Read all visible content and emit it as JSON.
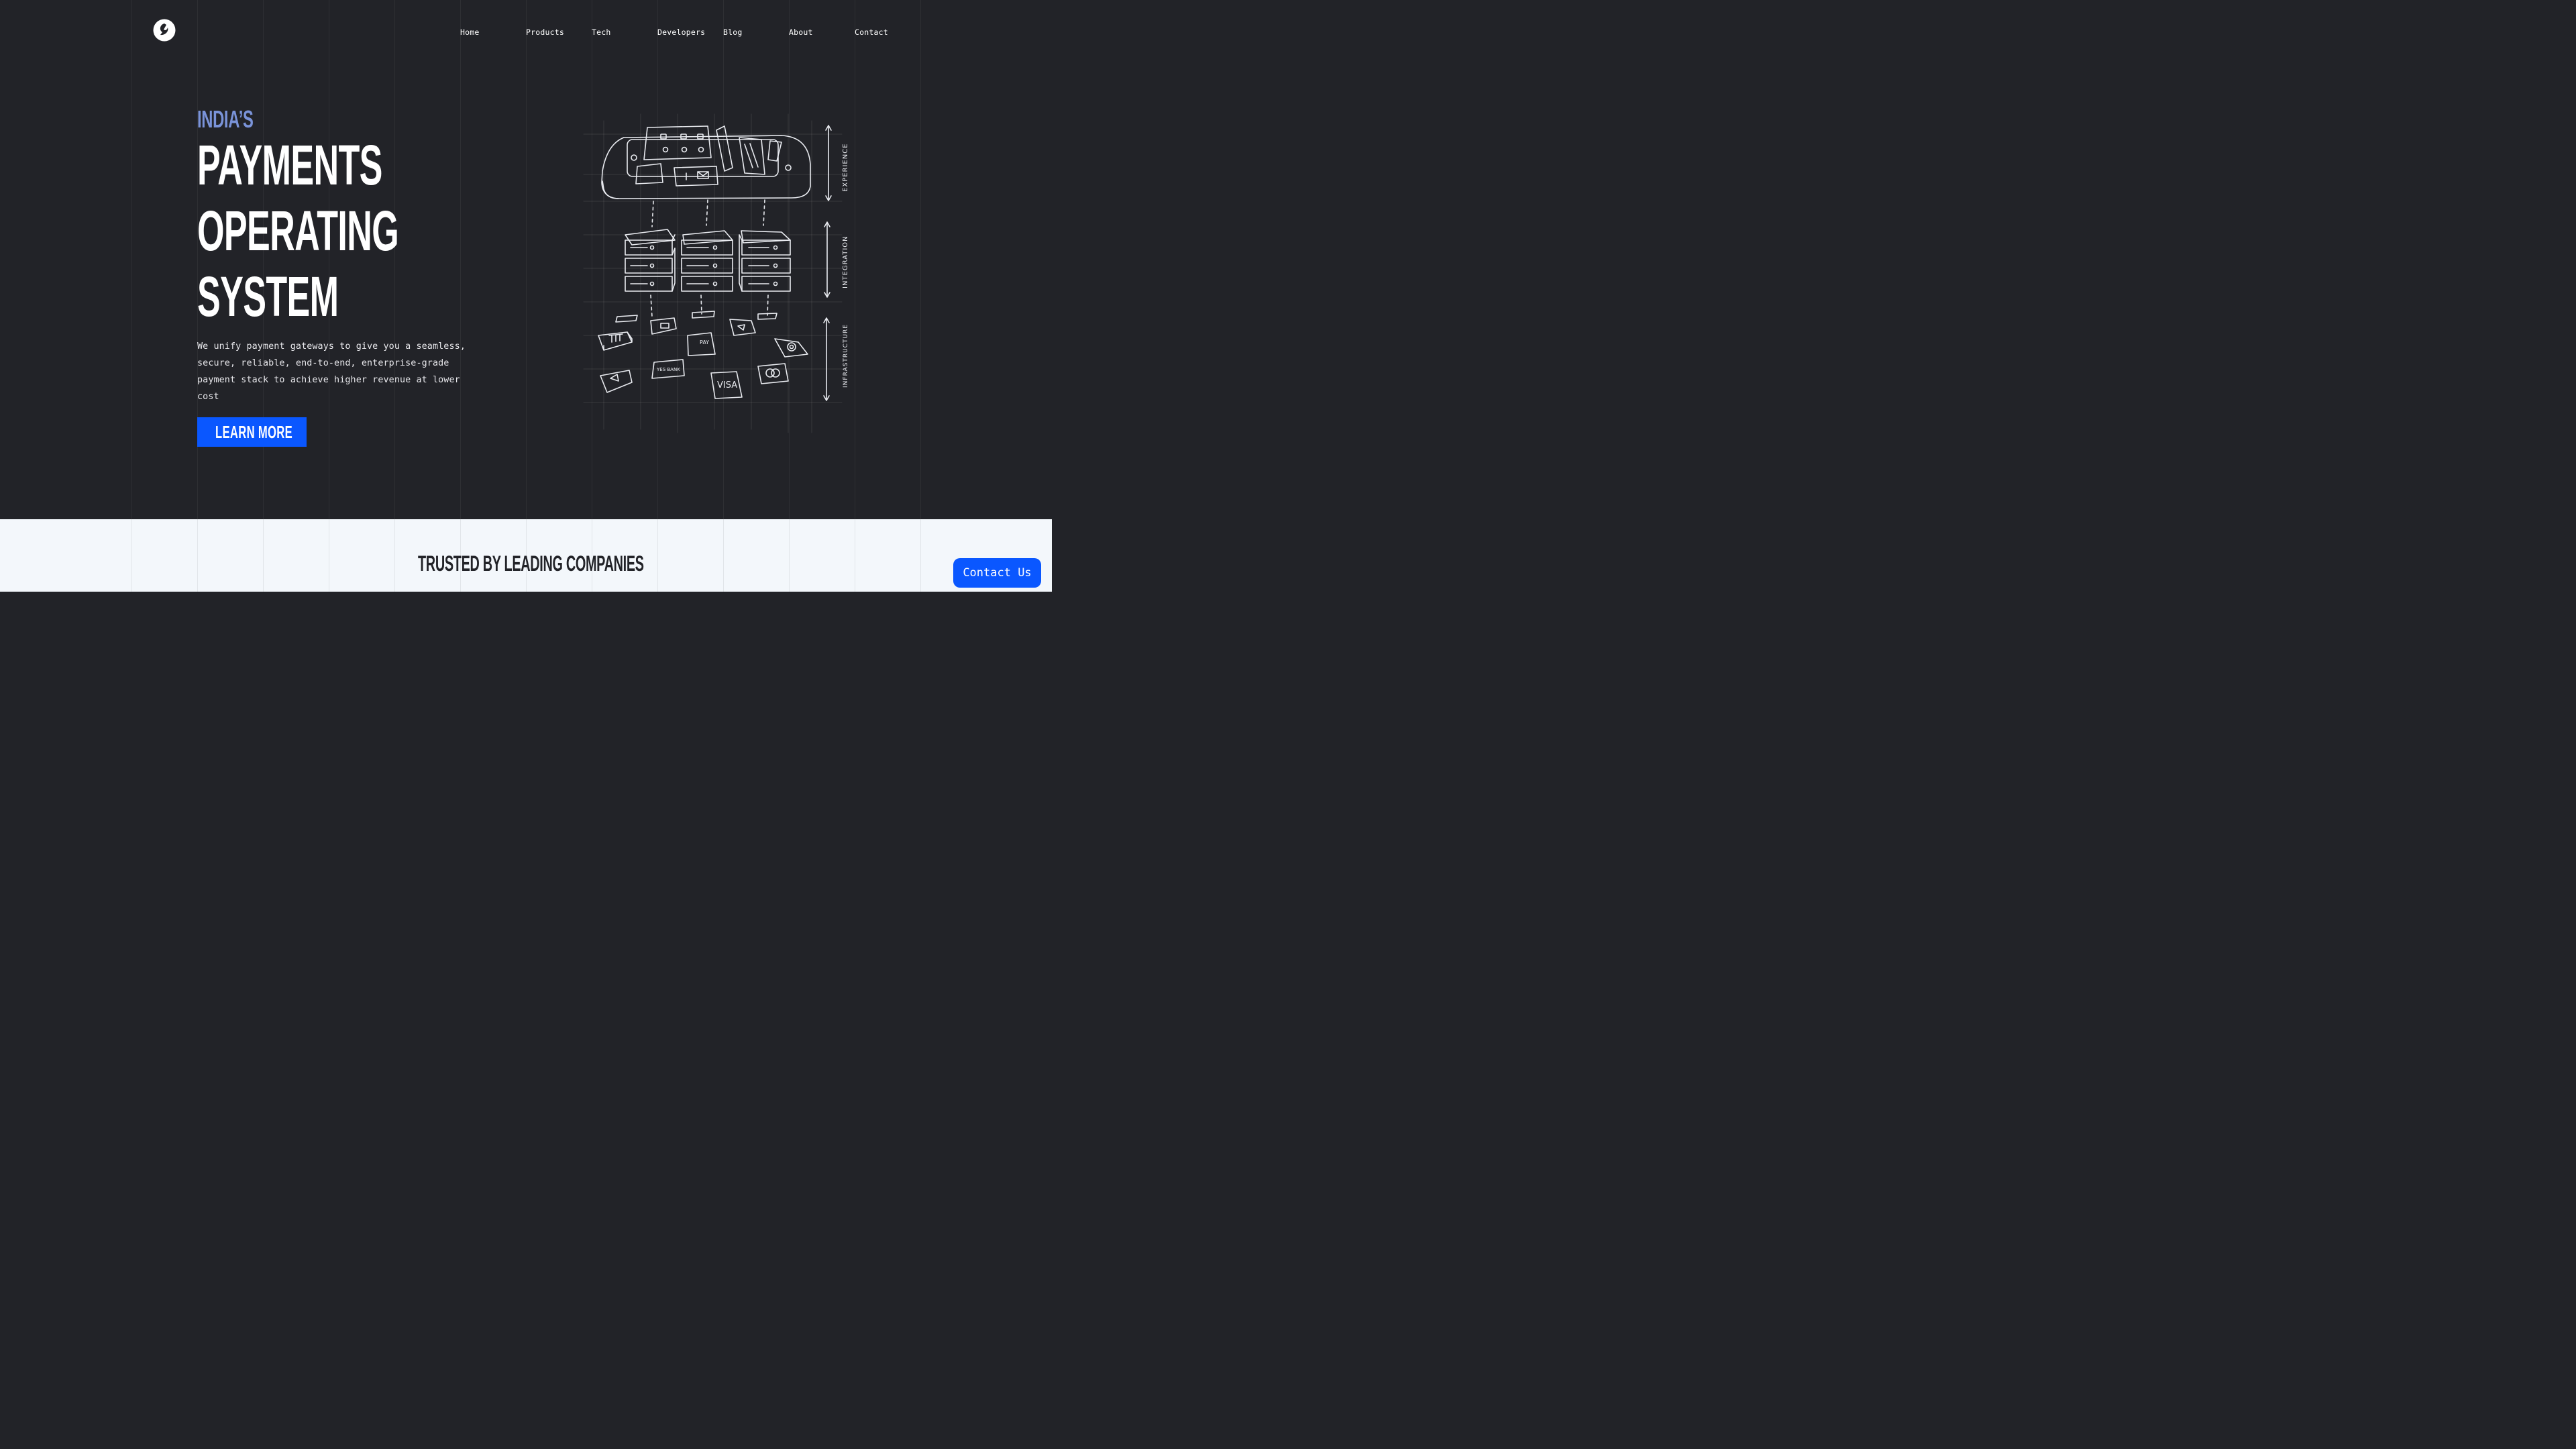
{
  "brand": {
    "logo_icon": "brand-swirl-logo-icon",
    "accent_color": "#0a57ff",
    "eyebrow_color": "#7a93d9",
    "dark_bg": "#222328",
    "light_bg": "#f3f7fb"
  },
  "nav": {
    "items": [
      {
        "label": "Home"
      },
      {
        "label": "Products"
      },
      {
        "label": "Tech"
      },
      {
        "label": "Developers"
      },
      {
        "label": "Blog"
      },
      {
        "label": "About"
      },
      {
        "label": "Contact"
      }
    ]
  },
  "hero": {
    "eyebrow": "INDIA’S",
    "headline_lines": [
      "PAYMENTS",
      "OPERATING",
      "SYSTEM"
    ],
    "description": "We unify payment gateways to give you a seamless, secure, reliable, end-to-end, enterprise-grade payment stack to achieve higher revenue at lower cost",
    "cta_label": "LEARN MORE"
  },
  "illustration": {
    "layers": [
      "EXPERIENCE",
      "INTEGRATION",
      "INFRASTRUCTURE"
    ],
    "tile_labels": [
      "PAY",
      "YES BANK",
      "VISA"
    ]
  },
  "trusted": {
    "title": "TRUSTED BY LEADING COMPANIES"
  },
  "floating": {
    "contact_label": "Contact Us"
  }
}
